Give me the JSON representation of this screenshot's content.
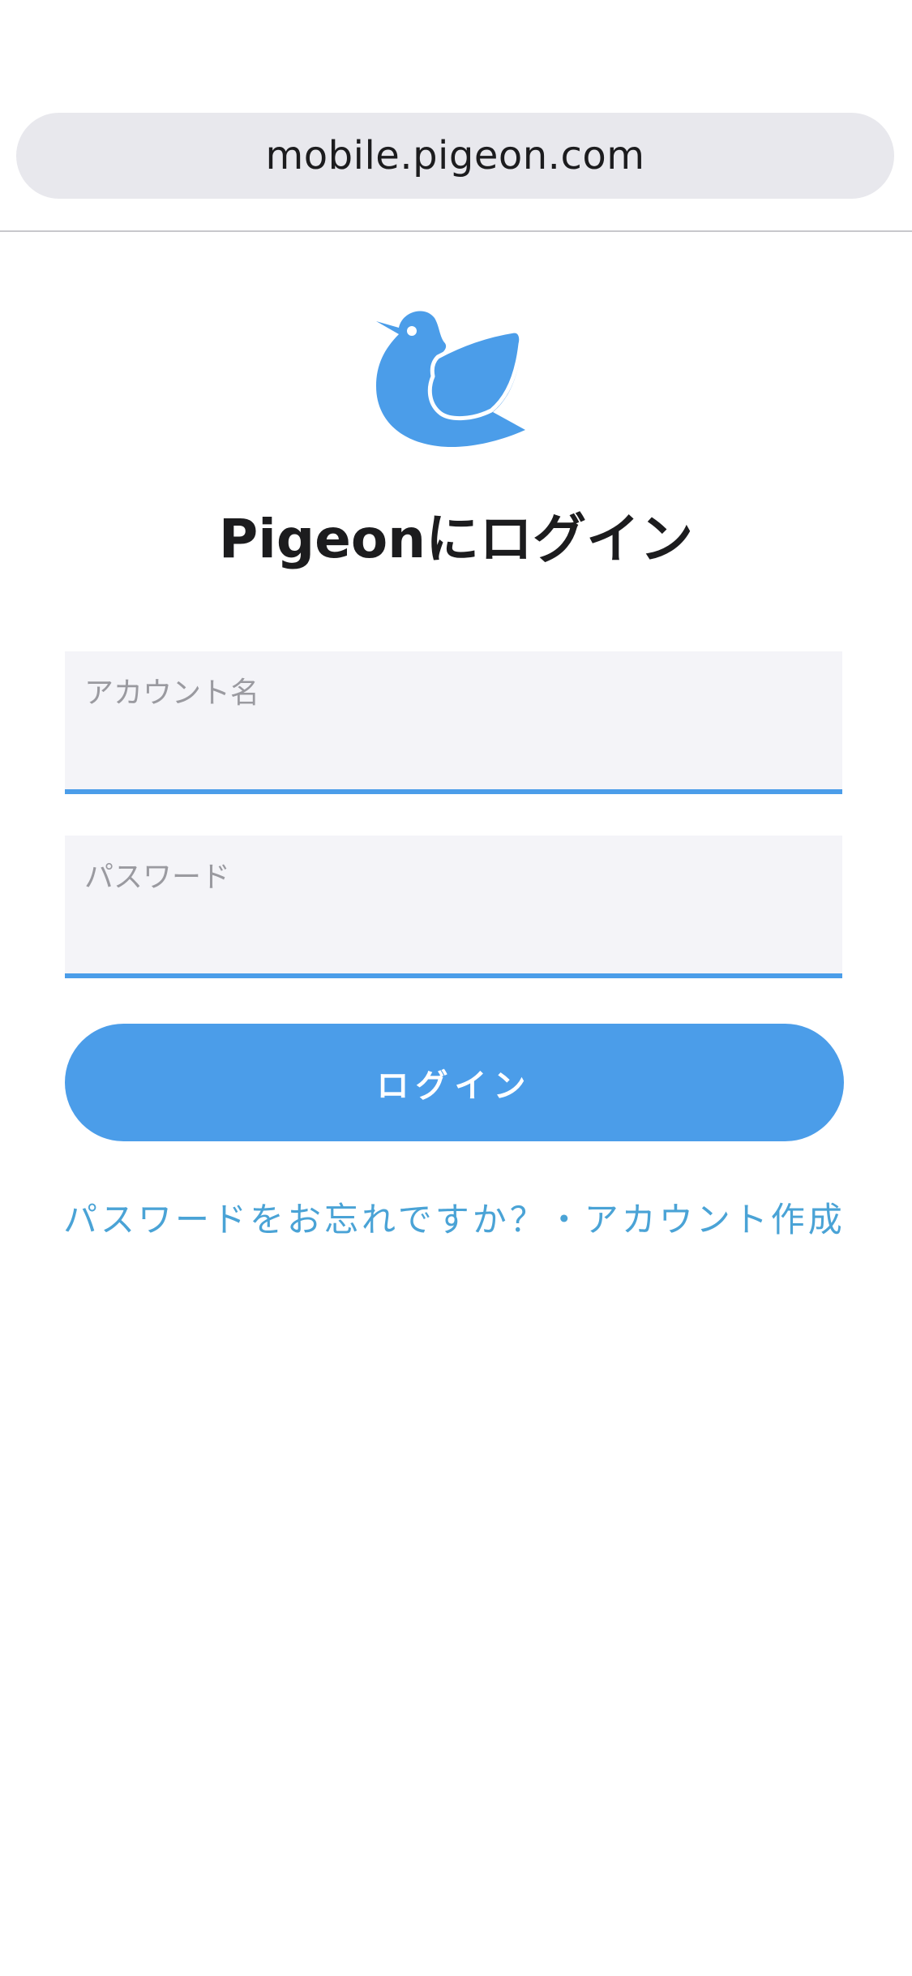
{
  "browser": {
    "url": "mobile.pigeon.com"
  },
  "logo": {
    "icon": "pigeon-bird-icon",
    "color": "#4b9de9"
  },
  "page": {
    "title": "Pigeonにログイン"
  },
  "form": {
    "username_label": "アカウント名",
    "password_label": "パスワード",
    "username_value": "",
    "password_value": "",
    "login_button": "ログイン"
  },
  "links": {
    "forgot_password": "パスワードをお忘れですか？",
    "separator": "・",
    "create_account": "アカウント作成"
  },
  "colors": {
    "accent": "#4b9de9",
    "link": "#4aa3d6",
    "field_background": "#f4f4f8",
    "url_bar_background": "#e8e8ed"
  }
}
